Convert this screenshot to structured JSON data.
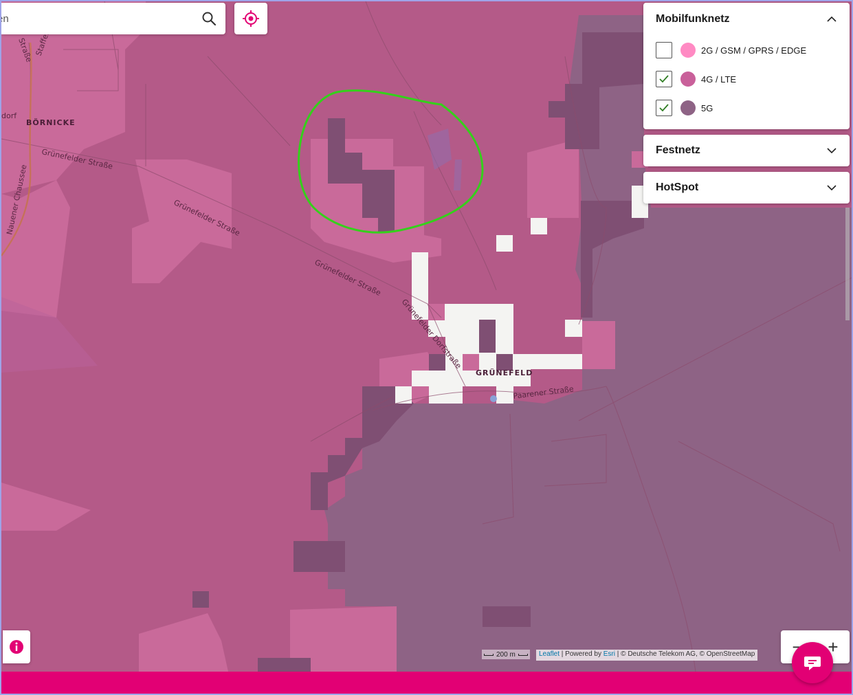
{
  "search": {
    "value": "en",
    "placeholder": ""
  },
  "map": {
    "places": {
      "boernicke": "BÖRNICKE",
      "gruenefeld": "GRÜNEFELD"
    },
    "streets": {
      "staffel": "Staffel",
      "strasse_top": "Straße",
      "gruenefelder_1": "Grünefelder Straße",
      "gruenefelder_2": "Grünefelder Straße",
      "gruenefelder_3": "Grünefelder Straße",
      "nauener": "Nauener Chaussee",
      "dorfstrasse": "Grünefelder Dorfstraße",
      "paarener": "Paarener Straße",
      "dorf_left": "dorf"
    },
    "colors": {
      "coverage_4g": "#b45a88",
      "coverage_5g": "#8e6385",
      "coverage_2g_light": "#c96a9a",
      "coverage_dark": "#7f4f73",
      "no_coverage": "#f4f4f2",
      "annotation_circle": "#34d11b"
    }
  },
  "panels": {
    "mobilfunknetz": {
      "title": "Mobilfunknetz",
      "expanded": true,
      "items": [
        {
          "label": "2G / GSM / GPRS / EDGE",
          "checked": false,
          "color": "#ff8ac3"
        },
        {
          "label": "4G / LTE",
          "checked": true,
          "color": "#c9609a"
        },
        {
          "label": "5G",
          "checked": true,
          "color": "#8e6385"
        }
      ]
    },
    "festnetz": {
      "title": "Festnetz",
      "expanded": false
    },
    "hotspot": {
      "title": "HotSpot",
      "expanded": false
    }
  },
  "controls": {
    "zoom_out": "−",
    "zoom_in": "+",
    "info_icon": "info-icon",
    "chat_icon": "chat-icon",
    "locate_icon": "locate-icon"
  },
  "scale": {
    "label": "200 m"
  },
  "attribution": {
    "leaflet": "Leaflet",
    "sep1": " | Powered by ",
    "esri": "Esri",
    "rest": " | © Deutsche Telekom AG, © OpenStreetMap"
  },
  "brand": {
    "magenta": "#e20074"
  }
}
